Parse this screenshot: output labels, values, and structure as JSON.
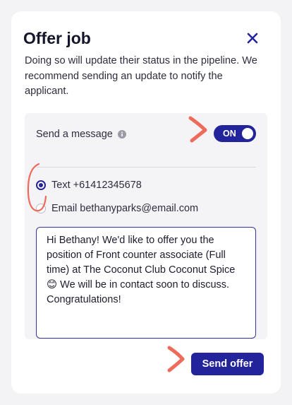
{
  "modal": {
    "title": "Offer job",
    "description": "Doing so will update their status in the pipeline. We recommend sending an update to notify the applicant."
  },
  "message_settings": {
    "send_label": "Send a message",
    "toggle_label": "ON",
    "toggle_on": true
  },
  "channels": [
    {
      "label": "Text +61412345678",
      "checked": true
    },
    {
      "label": "Email bethanyparks@email.com",
      "checked": false
    }
  ],
  "message": {
    "value": "Hi Bethany! We'd like to offer you the position of Front counter associate (Full time) at The Coconut Club Coconut Spice 😊 We will be in contact soon to discuss. Congratulations!"
  },
  "footer": {
    "send_offer_label": "Send offer"
  },
  "colors": {
    "accent": "#23239c",
    "annotation": "#ee6a5a"
  },
  "icons": {
    "close": "close-icon",
    "info": "info-icon"
  }
}
